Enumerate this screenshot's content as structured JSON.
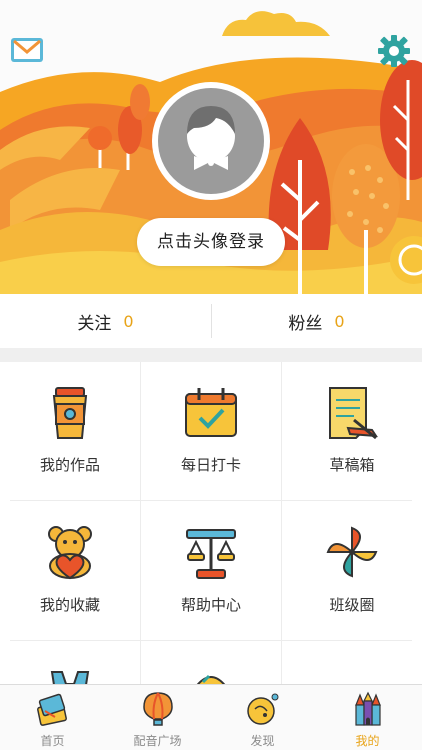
{
  "header": {
    "login_label": "点击头像登录"
  },
  "stats": {
    "following_label": "关注",
    "following_count": "0",
    "followers_label": "粉丝",
    "followers_count": "0"
  },
  "grid": {
    "items": [
      {
        "label": "我的作品",
        "icon": "cup-icon"
      },
      {
        "label": "每日打卡",
        "icon": "calendar-check-icon"
      },
      {
        "label": "草稿箱",
        "icon": "draft-note-icon"
      },
      {
        "label": "我的收藏",
        "icon": "teddy-bear-heart-icon"
      },
      {
        "label": "帮助中心",
        "icon": "balance-scale-icon"
      },
      {
        "label": "班级圈",
        "icon": "pinwheel-icon"
      }
    ]
  },
  "tabbar": {
    "items": [
      {
        "label": "首页",
        "icon": "home-books-icon"
      },
      {
        "label": "配音广场",
        "icon": "hot-air-balloon-icon"
      },
      {
        "label": "发现",
        "icon": "discover-planet-icon"
      },
      {
        "label": "我的",
        "icon": "castle-icon"
      }
    ],
    "active_index": 3
  },
  "colors": {
    "accent": "#e8a317",
    "banner_orange": "#ef7a2e",
    "banner_yellow": "#f7c43a",
    "avatar_gray": "#9b9b9b"
  }
}
